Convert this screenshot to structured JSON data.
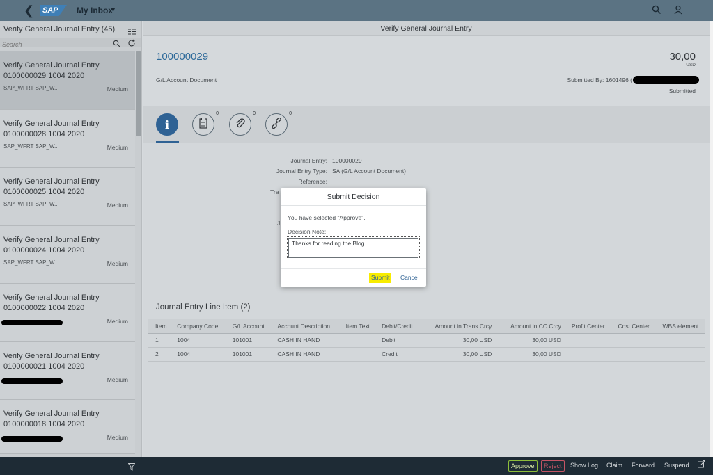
{
  "shell": {
    "logo": "SAP",
    "app_title": "My Inbox"
  },
  "master": {
    "title": "Verify General Journal Entry (45)",
    "search_placeholder": "Search",
    "items": [
      {
        "title": "Verify General Journal Entry",
        "subtitle": "0100000029 1004 2020",
        "creator": "SAP_WFRT SAP_W...",
        "priority": "Medium",
        "selected": true
      },
      {
        "title": "Verify General Journal Entry",
        "subtitle": "0100000028 1004 2020",
        "creator": "SAP_WFRT SAP_W...",
        "priority": "Medium"
      },
      {
        "title": "Verify General Journal Entry",
        "subtitle": "0100000025 1004 2020",
        "creator": "SAP_WFRT SAP_W...",
        "priority": "Medium"
      },
      {
        "title": "Verify General Journal Entry",
        "subtitle": "0100000024 1004 2020",
        "creator": "SAP_WFRT SAP_W...",
        "priority": "Medium"
      },
      {
        "title": "Verify General Journal Entry",
        "subtitle": "0100000022 1004 2020",
        "creator": "",
        "priority": "Medium"
      },
      {
        "title": "Verify General Journal Entry",
        "subtitle": "0100000021 1004 2020",
        "creator": "",
        "priority": "Medium"
      },
      {
        "title": "Verify General Journal Entry",
        "subtitle": "0100000018 1004 2020",
        "creator": "",
        "priority": "Medium"
      }
    ]
  },
  "detail": {
    "title": "Verify General Journal Entry",
    "doc_number": "100000029",
    "doc_type": "G/L Account Document",
    "amount": "30,00",
    "currency": "USD",
    "submitted_by": "Submitted By: 1601496 (",
    "status": "Submitted",
    "tab_counts": [
      "0",
      "0",
      "0"
    ],
    "fields": [
      {
        "label": "Journal Entry:",
        "value": "100000029"
      },
      {
        "label": "Journal Entry Type:",
        "value": "SA (G/L Account Document)"
      },
      {
        "label": "Reference:",
        "value": ""
      }
    ],
    "partial_labels": [
      "Tra",
      "J"
    ],
    "line_items_title": "Journal Entry Line Item (2)",
    "columns": [
      "Item",
      "Company Code",
      "G/L Account",
      "Account Description",
      "Item Text",
      "Debit/Credit",
      "Amount in Trans Crcy",
      "Amount in CC Crcy",
      "Profit Center",
      "Cost Center",
      "WBS element"
    ],
    "rows": [
      [
        "1",
        "1004",
        "101001",
        "CASH IN HAND",
        "",
        "Debit",
        "30,00  USD",
        "30,00  USD",
        "",
        "",
        ""
      ],
      [
        "2",
        "1004",
        "101001",
        "CASH IN HAND",
        "",
        "Credit",
        "30,00  USD",
        "30,00  USD",
        "",
        "",
        ""
      ]
    ]
  },
  "dialog": {
    "title": "Submit Decision",
    "message": "You have selected \"Approve\".",
    "note_label": "Decision Note:",
    "note_value": "Thanks for reading the Blog...",
    "submit": "Submit",
    "cancel": "Cancel"
  },
  "footer": {
    "approve": "Approve",
    "reject": "Reject",
    "show_log": "Show Log",
    "claim": "Claim",
    "forward": "Forward",
    "suspend": "Suspend"
  },
  "colors": {
    "accent": "#2f6294",
    "highlight": "#f8ec00",
    "shell": "#5b7383",
    "footer": "#1e2b35"
  }
}
